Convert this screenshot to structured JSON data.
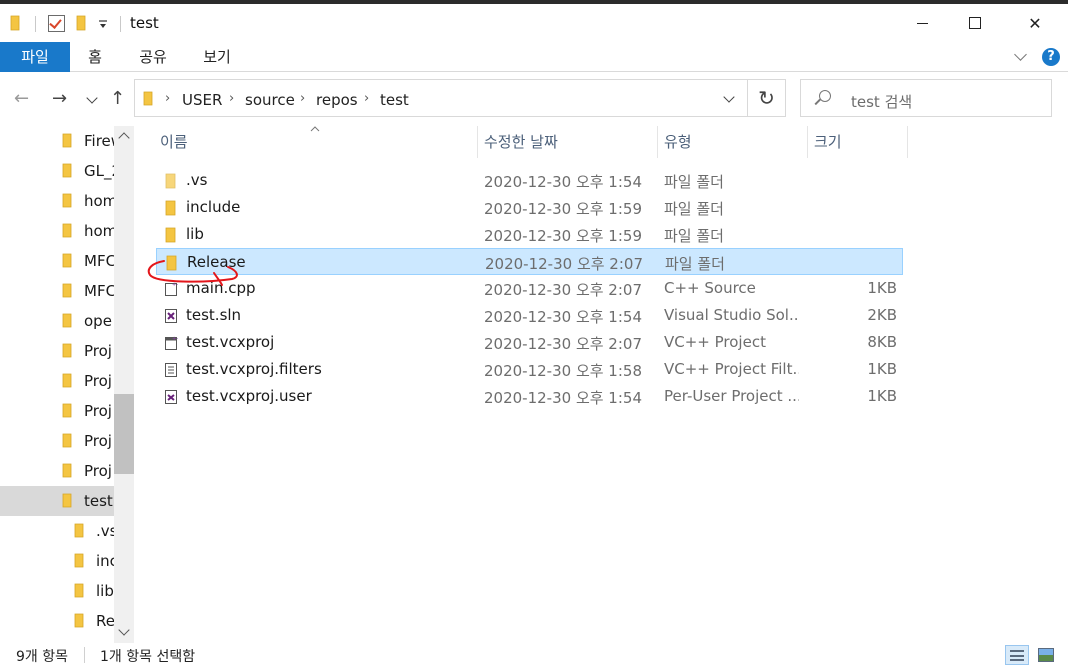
{
  "window": {
    "title": "test",
    "minimize_icon": "minimize-icon",
    "maximize_icon": "maximize-icon",
    "close_icon": "close-icon",
    "close_glyph": "✕"
  },
  "ribbon": {
    "tabs": [
      {
        "label": "파일",
        "active": true
      },
      {
        "label": "홈"
      },
      {
        "label": "공유"
      },
      {
        "label": "보기"
      }
    ],
    "help_label": "?",
    "accent_color": "#1979ca"
  },
  "nav": {
    "back_glyph": "←",
    "forward_glyph": "→",
    "up_glyph": "↑",
    "refresh_glyph": "↻",
    "breadcrumbs": [
      "USER",
      "source",
      "repos",
      "test"
    ],
    "crumb_sep": "›",
    "search_placeholder": "test 검색"
  },
  "tree": {
    "items": [
      {
        "label": "Firew"
      },
      {
        "label": "GL_2"
      },
      {
        "label": "hom"
      },
      {
        "label": "hom"
      },
      {
        "label": "MFC"
      },
      {
        "label": "MFC"
      },
      {
        "label": "ope"
      },
      {
        "label": "Proj"
      },
      {
        "label": "Proj"
      },
      {
        "label": "Proj"
      },
      {
        "label": "Proj"
      },
      {
        "label": "Proj"
      },
      {
        "label": "test",
        "selected": true
      },
      {
        "label": ".vs",
        "child": true
      },
      {
        "label": "inc",
        "child": true
      },
      {
        "label": "lib",
        "child": true
      },
      {
        "label": "Re",
        "child": true
      }
    ]
  },
  "columns": {
    "name": "이름",
    "date": "수정한 날짜",
    "type": "유형",
    "size": "크기"
  },
  "files": [
    {
      "name": ".vs",
      "date": "2020-12-30 오후 1:54",
      "type": "파일 폴더",
      "size": "",
      "icon": "folder-icon"
    },
    {
      "name": "include",
      "date": "2020-12-30 오후 1:59",
      "type": "파일 폴더",
      "size": "",
      "icon": "folder-icon"
    },
    {
      "name": "lib",
      "date": "2020-12-30 오후 1:59",
      "type": "파일 폴더",
      "size": "",
      "icon": "folder-icon"
    },
    {
      "name": "Release",
      "date": "2020-12-30 오후 2:07",
      "type": "파일 폴더",
      "size": "",
      "icon": "folder-icon",
      "selected": true
    },
    {
      "name": "main.cpp",
      "date": "2020-12-30 오후 2:07",
      "type": "C++ Source",
      "size": "1KB",
      "icon": "cpp-file-icon"
    },
    {
      "name": "test.sln",
      "date": "2020-12-30 오후 1:54",
      "type": "Visual Studio Sol...",
      "size": "2KB",
      "icon": "solution-file-icon"
    },
    {
      "name": "test.vcxproj",
      "date": "2020-12-30 오후 2:07",
      "type": "VC++ Project",
      "size": "8KB",
      "icon": "vcxproj-file-icon"
    },
    {
      "name": "test.vcxproj.filters",
      "date": "2020-12-30 오후 1:58",
      "type": "VC++ Project Filt...",
      "size": "1KB",
      "icon": "filters-file-icon"
    },
    {
      "name": "test.vcxproj.user",
      "date": "2020-12-30 오후 1:54",
      "type": "Per-User Project ...",
      "size": "1KB",
      "icon": "user-file-icon"
    }
  ],
  "status": {
    "item_count": "9개 항목",
    "selection": "1개 항목 선택함"
  },
  "colors": {
    "folder": "#f4c542",
    "selection_bg": "#cce8ff",
    "selection_border": "#99d1ff",
    "annotation": "#e3161b"
  }
}
